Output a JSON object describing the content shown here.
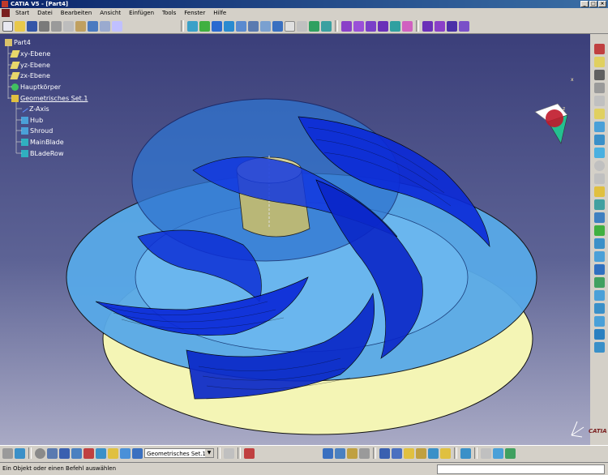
{
  "window": {
    "title": "CATIA V5 - [Part4]"
  },
  "menu": [
    "Start",
    "Datei",
    "Bearbeiten",
    "Ansicht",
    "Einfügen",
    "Tools",
    "Fenster",
    "Hilfe"
  ],
  "tree": {
    "root": "Part4",
    "items": [
      "xy-Ebene",
      "yz-Ebene",
      "zx-Ebene",
      "Hauptkörper",
      "Geometrisches Set.1",
      "Z-Axis",
      "Hub",
      "Shroud",
      "MainBlade",
      "BLadeRow"
    ]
  },
  "bottom_toolbar": {
    "set_select": "Geometrisches Set.1"
  },
  "status": {
    "text": "Ein Objekt oder einen Befehl auswählen"
  },
  "logo": "CATIA",
  "colors": {
    "accent": "#0a246a",
    "viewport_top": "#3b3f7a",
    "blade": "#0b2ad8",
    "disc_yellow": "#f4f5b5"
  }
}
